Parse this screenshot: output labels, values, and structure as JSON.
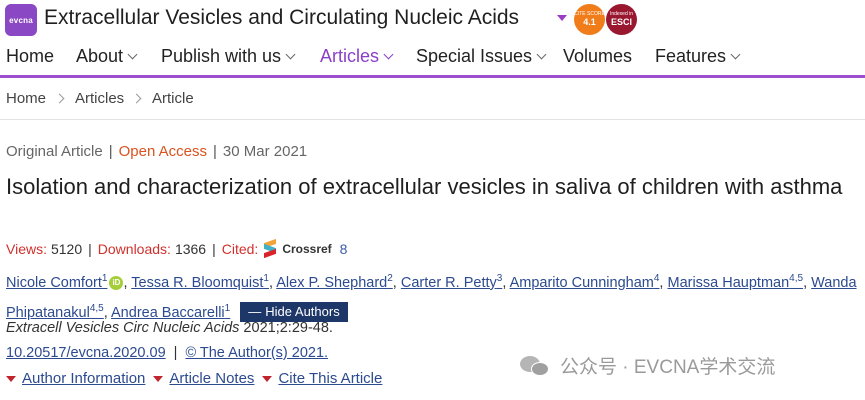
{
  "header": {
    "logo_text": "evcna",
    "journal_title": "Extracellular Vesicles and Circulating Nucleic Acids",
    "badges": [
      {
        "top": "CITE SCORE",
        "value": "4.1",
        "color": "#f07d1a"
      },
      {
        "top": "Indexed in",
        "value": "ESCI",
        "color": "#9a1730"
      }
    ]
  },
  "nav": {
    "items": [
      {
        "label": "Home",
        "has_dropdown": false
      },
      {
        "label": "About",
        "has_dropdown": true
      },
      {
        "label": "Publish with us",
        "has_dropdown": true
      },
      {
        "label": "Articles",
        "has_dropdown": true,
        "active": true
      },
      {
        "label": "Special Issues",
        "has_dropdown": true
      },
      {
        "label": "Volumes",
        "has_dropdown": false
      },
      {
        "label": "Features",
        "has_dropdown": true
      }
    ],
    "accent_color": "#9b4fd0"
  },
  "breadcrumb": [
    "Home",
    "Articles",
    "Article"
  ],
  "article": {
    "type": "Original Article",
    "access": "Open Access",
    "date": "30 Mar 2021",
    "title": "Isolation and characterization of extracellular vesicles in saliva of children with asthma",
    "stats": {
      "views_label": "Views:",
      "views": "5120",
      "downloads_label": "Downloads:",
      "downloads": "1366",
      "cited_label": "Cited:",
      "crossref_label": "Crossref",
      "cited": "8"
    },
    "authors": [
      {
        "name": "Nicole Comfort",
        "aff": "1",
        "orcid": true
      },
      {
        "name": "Tessa R. Bloomquist",
        "aff": "1"
      },
      {
        "name": "Alex P. Shephard",
        "aff": "2"
      },
      {
        "name": "Carter R. Petty",
        "aff": "3"
      },
      {
        "name": "Amparito Cunningham",
        "aff": "4"
      },
      {
        "name": "Marissa Hauptman",
        "aff": "4,5"
      },
      {
        "name": "Wanda Phipatanakul",
        "aff": "4,5"
      },
      {
        "name": "Andrea Baccarelli",
        "aff": "1"
      }
    ],
    "hide_authors_label": "Hide Authors",
    "journal_abbrev": "Extracell Vesicles Circ Nucleic Acids",
    "citation_rest": " 2021;2:29-48.",
    "doi": "10.20517/evcna.2020.09",
    "copyright": "© The Author(s) 2021.",
    "sections": [
      "Author Information",
      "Article Notes",
      "Cite This Article"
    ]
  },
  "watermark": "公众号 · EVCNA学术交流"
}
